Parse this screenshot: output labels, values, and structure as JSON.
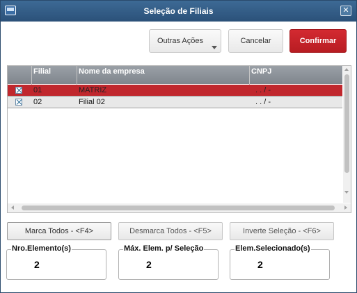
{
  "window": {
    "title": "Seleção de Filiais"
  },
  "toolbar": {
    "outras_label": "Outras Ações",
    "cancel_label": "Cancelar",
    "confirm_label": "Confirmar"
  },
  "grid": {
    "columns": [
      "",
      "Filial",
      "Nome da empresa",
      "CNPJ"
    ],
    "rows": [
      {
        "checked": true,
        "filial": "01",
        "nome": "MATRIZ",
        "cnpj": ". . / -",
        "selected": true
      },
      {
        "checked": true,
        "filial": "02",
        "nome": "Filial 02",
        "cnpj": ". . / -",
        "selected": false
      }
    ]
  },
  "actions": {
    "mark_all": "Marca Todos - <F4>",
    "unmark_all": "Desmarca Todos - <F5>",
    "invert": "Inverte Seleção - <F6>"
  },
  "counters": [
    {
      "label": "Nro.Elemento(s)",
      "value": "2"
    },
    {
      "label": "Máx. Elem. p/ Seleção",
      "value": "2"
    },
    {
      "label": "Elem.Selecionado(s)",
      "value": "2"
    }
  ],
  "colors": {
    "titlebar": "#2b5179",
    "confirm": "#c0272d",
    "selected_row": "#c0272d"
  },
  "icons": {
    "app": "window-icon",
    "close": "close-icon",
    "caret": "chevron-down-icon",
    "check": "checkbox-checked-icon"
  }
}
